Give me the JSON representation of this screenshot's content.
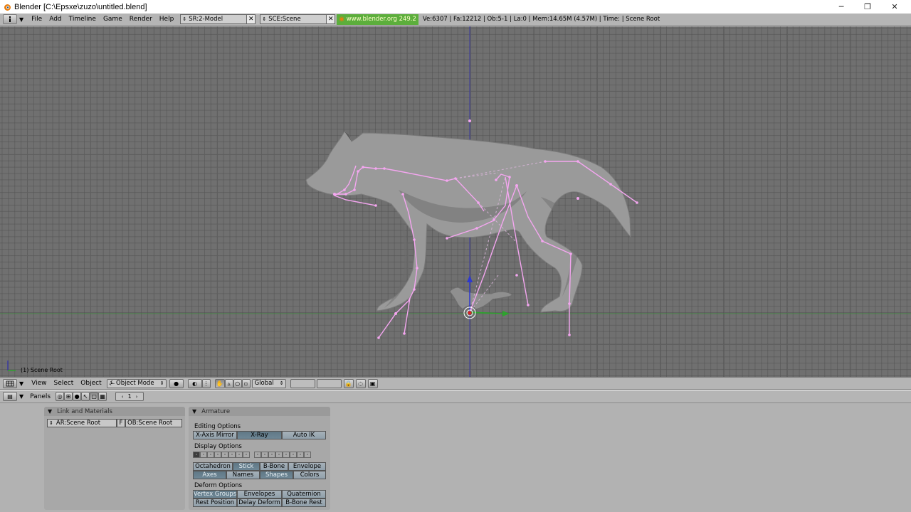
{
  "window": {
    "title": "Blender [C:\\Epsxe\\zuzo\\untitled.blend]",
    "minimize_glyph": "─",
    "restore_glyph": "❐",
    "close_glyph": "✕"
  },
  "info_header": {
    "menus": [
      "File",
      "Add",
      "Timeline",
      "Game",
      "Render",
      "Help"
    ],
    "screen_field": "SR:2-Model",
    "scene_field": "SCE:Scene",
    "link": "www.blender.org 249.2",
    "stats": "Ve:6307 | Fa:12212 | Ob:5-1 | La:0  | Mem:14.65M (4.57M)  | Time: | Scene Root"
  },
  "viewport": {
    "label": "(1) Scene Root"
  },
  "view3d_header": {
    "menus": [
      "View",
      "Select",
      "Object"
    ],
    "mode": "Object Mode",
    "orientation": "Global"
  },
  "buttons_header": {
    "panels_label": "Panels",
    "frame": "1"
  },
  "link_panel": {
    "title": "Link and Materials",
    "armature_field": "AR:Scene Root",
    "fake_user": "F",
    "object_field": "OB:Scene Root"
  },
  "armature_panel": {
    "title": "Armature",
    "editing_label": "Editing Options",
    "editing_buttons": [
      "X-Axis Mirror",
      "X-Ray",
      "Auto IK"
    ],
    "display_label": "Display Options",
    "display_row1": [
      "Octahedron",
      "Stick",
      "B-Bone",
      "Envelope"
    ],
    "display_row2": [
      "Axes",
      "Names",
      "Shapes",
      "Colors"
    ],
    "deform_label": "Deform Options",
    "deform_row1": [
      "Vertex Groups",
      "Envelopes",
      "Quaternion"
    ],
    "deform_row2": [
      "Rest Position",
      "Delay Deform",
      "B-Bone Rest"
    ]
  },
  "colors": {
    "bone": "#f4a6f0",
    "viewport_bg": "#707070",
    "axis_z": "#3a3aa0",
    "axis_y": "#3e8a3e",
    "toggle_on": "#6a8594",
    "link_green": "#5cae3c"
  }
}
